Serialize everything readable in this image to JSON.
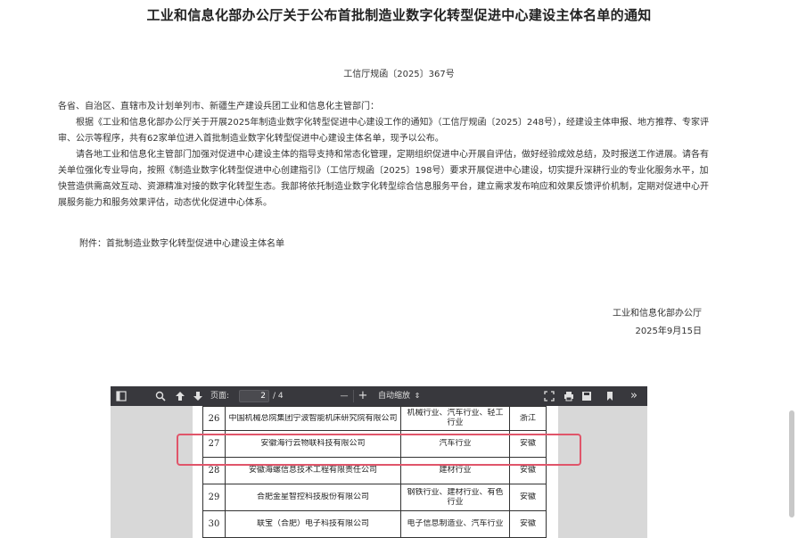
{
  "document": {
    "title": "工业和信息化部办公厅关于公布首批制造业数字化转型促进中心建设主体名单的通知",
    "doc_number": "工信厅规函〔2025〕367号",
    "salutation": "各省、自治区、直辖市及计划单列市、新疆生产建设兵团工业和信息化主管部门：",
    "paragraph_1": "根据《工业和信息化部办公厅关于开展2025年制造业数字化转型促进中心建设工作的通知》（工信厅规函〔2025〕248号），经建设主体申报、地方推荐、专家评审、公示等程序，共有62家单位进入首批制造业数字化转型促进中心建设主体名单，现予以公布。",
    "paragraph_2": "请各地工业和信息化主管部门加强对促进中心建设主体的指导支持和常态化管理，定期组织促进中心开展自评估，做好经验成效总结，及时报送工作进展。请各有关单位强化专业导向，按照《制造业数字化转型促进中心创建指引》（工信厅规函〔2025〕198号）要求开展促进中心建设，切实提升深耕行业的专业化服务水平，加快营造供需高效互动、资源精准对接的数字化转型生态。我部将依托制造业数字化转型综合信息服务平台，建立需求发布响应和效果反馈评价机制，定期对促进中心开展服务能力和服务效果评估，动态优化促进中心体系。",
    "attachment": "附件：首批制造业数字化转型促进中心建设主体名单",
    "signature_org": "工业和信息化部办公厅",
    "signature_date": "2025年9月15日"
  },
  "viewer": {
    "page_label": "页面:",
    "current_page": "2",
    "total_pages": "/ 4",
    "zoom_minus": "—",
    "zoom_plus": "+",
    "zoom_label": "自动缩放",
    "zoom_chevron": "⇕",
    "more_label": "»"
  },
  "table": {
    "rows": [
      {
        "no": "26",
        "name": "中国机械总院集团宁波智能机床研究院有限公司",
        "industry": "机械行业、汽车行业、轻工行业",
        "province": "浙江"
      },
      {
        "no": "27",
        "name": "安徽海行云物联科技有限公司",
        "industry": "汽车行业",
        "province": "安徽"
      },
      {
        "no": "28",
        "name": "安徽海螺信息技术工程有限责任公司",
        "industry": "建材行业",
        "province": "安徽"
      },
      {
        "no": "29",
        "name": "合肥金星智控科技股份有限公司",
        "industry": "钢铁行业、建材行业、有色行业",
        "province": "安徽"
      },
      {
        "no": "30",
        "name": "联宝（合肥）电子科技有限公司",
        "industry": "电子信息制造业、汽车行业",
        "province": "安徽"
      }
    ]
  },
  "colors": {
    "highlight": "#e0556a",
    "toolbar": "#38383d"
  }
}
